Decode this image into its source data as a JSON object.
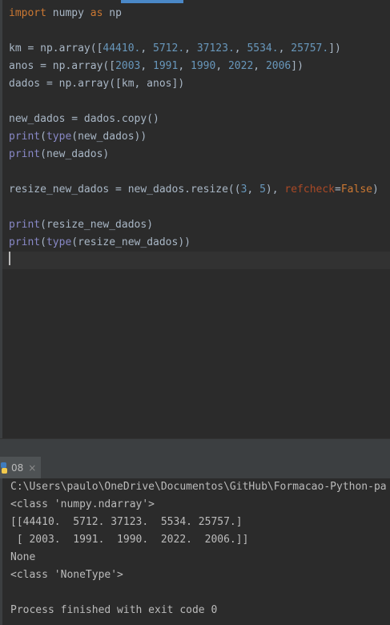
{
  "editor": {
    "lines": [
      {
        "segments": [
          {
            "t": "import",
            "c": "kw"
          },
          {
            "t": " numpy "
          },
          {
            "t": "as",
            "c": "kw"
          },
          {
            "t": " np"
          }
        ]
      },
      {
        "segments": []
      },
      {
        "segments": [
          {
            "t": "km = np.array(["
          },
          {
            "t": "44410.",
            "c": "num"
          },
          {
            "t": ", "
          },
          {
            "t": "5712.",
            "c": "num"
          },
          {
            "t": ", "
          },
          {
            "t": "37123.",
            "c": "num"
          },
          {
            "t": ", "
          },
          {
            "t": "5534.",
            "c": "num"
          },
          {
            "t": ", "
          },
          {
            "t": "25757.",
            "c": "num"
          },
          {
            "t": "])"
          }
        ]
      },
      {
        "segments": [
          {
            "t": "anos = np.array(["
          },
          {
            "t": "2003",
            "c": "num"
          },
          {
            "t": ", "
          },
          {
            "t": "1991",
            "c": "num"
          },
          {
            "t": ", "
          },
          {
            "t": "1990",
            "c": "num"
          },
          {
            "t": ", "
          },
          {
            "t": "2022",
            "c": "num"
          },
          {
            "t": ", "
          },
          {
            "t": "2006",
            "c": "num"
          },
          {
            "t": "])"
          }
        ]
      },
      {
        "segments": [
          {
            "t": "dados = np.array([km, anos])"
          }
        ]
      },
      {
        "segments": []
      },
      {
        "segments": [
          {
            "t": "new_dados = dados.copy()"
          }
        ]
      },
      {
        "segments": [
          {
            "t": "print",
            "c": "builtin"
          },
          {
            "t": "("
          },
          {
            "t": "type",
            "c": "builtin"
          },
          {
            "t": "(new_dados))"
          }
        ]
      },
      {
        "segments": [
          {
            "t": "print",
            "c": "builtin"
          },
          {
            "t": "(new_dados)"
          }
        ]
      },
      {
        "segments": []
      },
      {
        "segments": [
          {
            "t": "resize_new_dados = new_dados.resize(("
          },
          {
            "t": "3",
            "c": "num"
          },
          {
            "t": ", "
          },
          {
            "t": "5",
            "c": "num"
          },
          {
            "t": "), "
          },
          {
            "t": "refcheck",
            "c": "param"
          },
          {
            "t": "="
          },
          {
            "t": "False",
            "c": "kw"
          },
          {
            "t": ")"
          }
        ]
      },
      {
        "segments": []
      },
      {
        "segments": [
          {
            "t": "print",
            "c": "builtin"
          },
          {
            "t": "(resize_new_dados)"
          }
        ]
      },
      {
        "segments": [
          {
            "t": "print",
            "c": "builtin"
          },
          {
            "t": "("
          },
          {
            "t": "type",
            "c": "builtin"
          },
          {
            "t": "(resize_new_dados))"
          }
        ]
      },
      {
        "segments": [],
        "current": true
      }
    ]
  },
  "run_tab": {
    "label": "08",
    "close": "×"
  },
  "console": {
    "lines": [
      "C:\\Users\\paulo\\OneDrive\\Documentos\\GitHub\\Formacao-Python-pa",
      "<class 'numpy.ndarray'>",
      "[[44410.  5712. 37123.  5534. 25757.]",
      " [ 2003.  1991.  1990.  2022.  2006.]]",
      "None",
      "<class 'NoneType'>",
      "",
      "Process finished with exit code 0"
    ]
  }
}
